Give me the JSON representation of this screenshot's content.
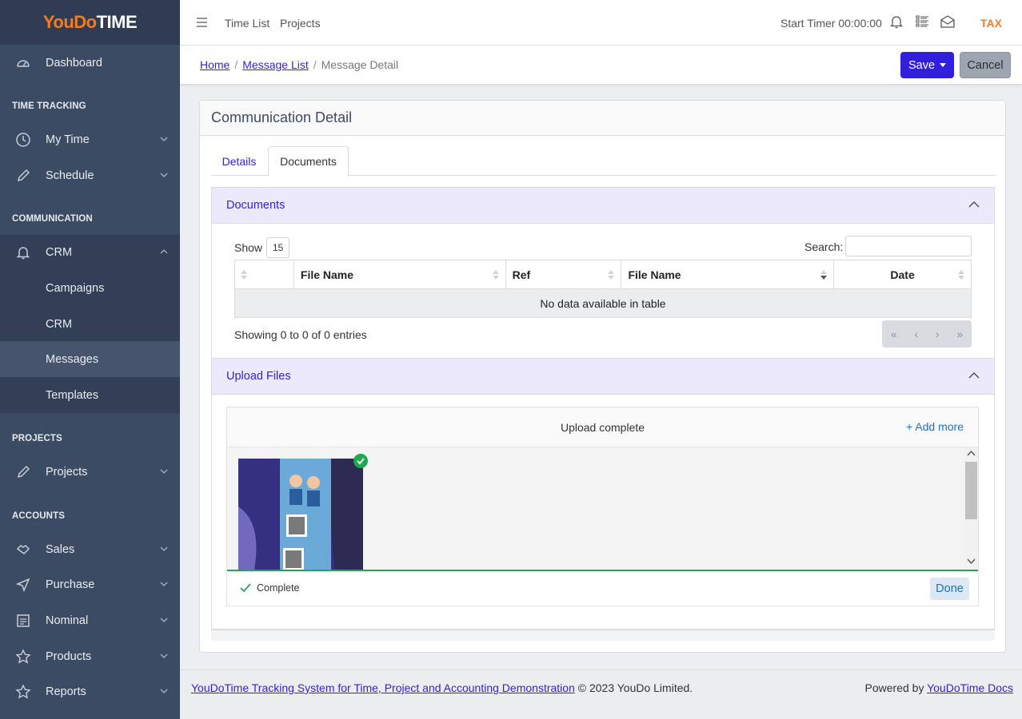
{
  "brand": {
    "part1": "YouDo",
    "part2": "TIME"
  },
  "sidebar": {
    "dashboard": "Dashboard",
    "sections": {
      "time_tracking": "TIME TRACKING",
      "communication": "COMMUNICATION",
      "projects": "PROJECTS",
      "accounts": "ACCOUNTS"
    },
    "items": {
      "my_time": "My Time",
      "schedule": "Schedule",
      "crm": "CRM",
      "campaigns": "Campaigns",
      "crm_sub": "CRM",
      "messages": "Messages",
      "templates": "Templates",
      "projects": "Projects",
      "sales": "Sales",
      "purchase": "Purchase",
      "nominal": "Nominal",
      "products": "Products",
      "reports": "Reports"
    }
  },
  "header": {
    "links": [
      "Time List",
      "Projects"
    ],
    "timer": "Start Timer 00:00:00",
    "tax": "TAX"
  },
  "breadcrumb": {
    "home": "Home",
    "list": "Message List",
    "current": "Message Detail"
  },
  "actions": {
    "save": "Save",
    "cancel": "Cancel"
  },
  "card": {
    "title": "Communication Detail",
    "tabs": [
      "Details",
      "Documents"
    ],
    "documents_panel": {
      "title": "Documents",
      "show_label": "Show",
      "show_value": "15",
      "search_label": "Search:",
      "columns": [
        "",
        "File Name",
        "Ref",
        "File Name",
        "Date"
      ],
      "empty": "No data available in table",
      "showing": "Showing 0 to 0 of 0 entries",
      "pager": [
        "«",
        "‹",
        "›",
        "»"
      ]
    },
    "upload_panel": {
      "title": "Upload Files",
      "status": "Upload complete",
      "add_more": "Add more",
      "complete": "Complete",
      "done": "Done"
    }
  },
  "footer": {
    "link": "YouDoTime Tracking System for Time, Project and Accounting Demonstration",
    "copyright": " © 2023 YouDo Limited.",
    "powered": "Powered by ",
    "docs": "YouDoTime Docs"
  },
  "colors": {
    "sidebar": "#3c4b64",
    "brand_orange": "#f47c20",
    "primary": "#321fdb",
    "success": "#1fa84f"
  }
}
